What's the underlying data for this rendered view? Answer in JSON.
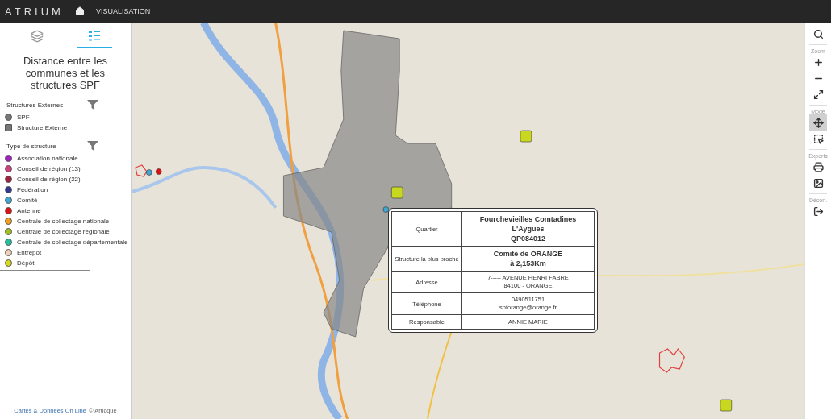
{
  "header": {
    "logo": "ATRIUM",
    "nav": [
      {
        "label": "VISUALISATION"
      }
    ]
  },
  "sidebar": {
    "tabs": [
      {
        "kind": "layers",
        "selected": false
      },
      {
        "kind": "legend",
        "selected": true
      }
    ],
    "title": "Distance entre les communes et les structures SPF",
    "legends": [
      {
        "title": "Structures Externes",
        "items": [
          {
            "label": "SPF",
            "kind": "circle",
            "color": "#777777"
          },
          {
            "label": "Structure Externe",
            "kind": "square",
            "color": "#777777"
          }
        ]
      },
      {
        "title": "Type de structure",
        "items": [
          {
            "label": "Association nationale",
            "kind": "circle",
            "color": "#a020c0"
          },
          {
            "label": "Conseil de région (13)",
            "kind": "circle",
            "color": "#d04080"
          },
          {
            "label": "Conseil de région (22)",
            "kind": "circle",
            "color": "#a02040"
          },
          {
            "label": "Fédération",
            "kind": "circle",
            "color": "#303890"
          },
          {
            "label": "Comité",
            "kind": "circle",
            "color": "#40a8d0"
          },
          {
            "label": "Antenne",
            "kind": "circle",
            "color": "#e01010"
          },
          {
            "label": "Centrale de collectage nationale",
            "kind": "circle",
            "color": "#f0a020"
          },
          {
            "label": "Centrale de collectage régionale",
            "kind": "circle",
            "color": "#a0c020"
          },
          {
            "label": "Centrale de collectage départementale",
            "kind": "circle",
            "color": "#20c0a0"
          },
          {
            "label": "Entrepôt",
            "kind": "circle",
            "color": "#f0d0b8"
          },
          {
            "label": "Dépôt",
            "kind": "circle",
            "color": "#d8d820"
          }
        ]
      }
    ],
    "footer": {
      "link": "Cartes & Données On Line",
      "text": "© Articque"
    }
  },
  "popup": {
    "rows": [
      {
        "label": "Quartier",
        "lines": [
          "Fourchevieilles Comtadines L'Aygues",
          "QP084012"
        ],
        "emphasis": true
      },
      {
        "label": "Structure la plus proche",
        "lines": [
          "Comité de ORANGE",
          "à 2,153Km"
        ],
        "emphasis": true
      },
      {
        "label": "Adresse",
        "lines": [
          "7----- AVENUE HENRI FABRE",
          "84100 - ORANGE"
        ],
        "emphasis": false
      },
      {
        "label": "Téléphone",
        "lines": [
          "0490511751",
          "spforange@orange.fr"
        ],
        "emphasis": false
      },
      {
        "label": "Responsable",
        "lines": [
          "ANNIE MARIE"
        ],
        "emphasis": false
      }
    ]
  },
  "toolbar": {
    "groups": [
      {
        "tools": [
          {
            "kind": "search",
            "selected": false
          }
        ]
      },
      {
        "label": "Zoom",
        "tools": [
          {
            "kind": "zoom-in",
            "selected": false
          },
          {
            "kind": "zoom-out",
            "selected": false
          },
          {
            "kind": "fit",
            "selected": false
          }
        ]
      },
      {
        "label": "Mode",
        "tools": [
          {
            "kind": "pan",
            "selected": true
          },
          {
            "kind": "select",
            "selected": false
          }
        ]
      },
      {
        "label": "Exports",
        "tools": [
          {
            "kind": "print",
            "selected": false
          },
          {
            "kind": "image",
            "selected": false
          }
        ]
      },
      {
        "label": "Décon.",
        "tools": [
          {
            "kind": "logout",
            "selected": false
          }
        ]
      }
    ]
  }
}
